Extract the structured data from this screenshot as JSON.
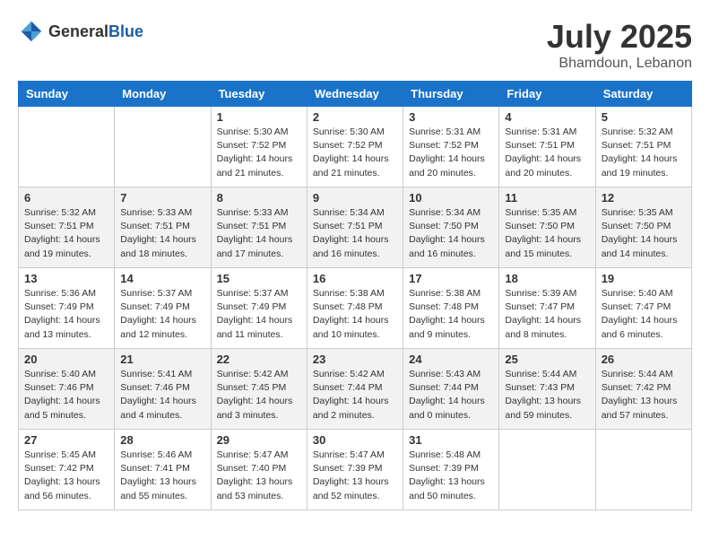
{
  "header": {
    "logo_general": "General",
    "logo_blue": "Blue",
    "month_year": "July 2025",
    "location": "Bhamdoun, Lebanon"
  },
  "weekdays": [
    "Sunday",
    "Monday",
    "Tuesday",
    "Wednesday",
    "Thursday",
    "Friday",
    "Saturday"
  ],
  "weeks": [
    [
      {
        "day": "",
        "sunrise": "",
        "sunset": "",
        "daylight": ""
      },
      {
        "day": "",
        "sunrise": "",
        "sunset": "",
        "daylight": ""
      },
      {
        "day": "1",
        "sunrise": "Sunrise: 5:30 AM",
        "sunset": "Sunset: 7:52 PM",
        "daylight": "Daylight: 14 hours and 21 minutes."
      },
      {
        "day": "2",
        "sunrise": "Sunrise: 5:30 AM",
        "sunset": "Sunset: 7:52 PM",
        "daylight": "Daylight: 14 hours and 21 minutes."
      },
      {
        "day": "3",
        "sunrise": "Sunrise: 5:31 AM",
        "sunset": "Sunset: 7:52 PM",
        "daylight": "Daylight: 14 hours and 20 minutes."
      },
      {
        "day": "4",
        "sunrise": "Sunrise: 5:31 AM",
        "sunset": "Sunset: 7:51 PM",
        "daylight": "Daylight: 14 hours and 20 minutes."
      },
      {
        "day": "5",
        "sunrise": "Sunrise: 5:32 AM",
        "sunset": "Sunset: 7:51 PM",
        "daylight": "Daylight: 14 hours and 19 minutes."
      }
    ],
    [
      {
        "day": "6",
        "sunrise": "Sunrise: 5:32 AM",
        "sunset": "Sunset: 7:51 PM",
        "daylight": "Daylight: 14 hours and 19 minutes."
      },
      {
        "day": "7",
        "sunrise": "Sunrise: 5:33 AM",
        "sunset": "Sunset: 7:51 PM",
        "daylight": "Daylight: 14 hours and 18 minutes."
      },
      {
        "day": "8",
        "sunrise": "Sunrise: 5:33 AM",
        "sunset": "Sunset: 7:51 PM",
        "daylight": "Daylight: 14 hours and 17 minutes."
      },
      {
        "day": "9",
        "sunrise": "Sunrise: 5:34 AM",
        "sunset": "Sunset: 7:51 PM",
        "daylight": "Daylight: 14 hours and 16 minutes."
      },
      {
        "day": "10",
        "sunrise": "Sunrise: 5:34 AM",
        "sunset": "Sunset: 7:50 PM",
        "daylight": "Daylight: 14 hours and 16 minutes."
      },
      {
        "day": "11",
        "sunrise": "Sunrise: 5:35 AM",
        "sunset": "Sunset: 7:50 PM",
        "daylight": "Daylight: 14 hours and 15 minutes."
      },
      {
        "day": "12",
        "sunrise": "Sunrise: 5:35 AM",
        "sunset": "Sunset: 7:50 PM",
        "daylight": "Daylight: 14 hours and 14 minutes."
      }
    ],
    [
      {
        "day": "13",
        "sunrise": "Sunrise: 5:36 AM",
        "sunset": "Sunset: 7:49 PM",
        "daylight": "Daylight: 14 hours and 13 minutes."
      },
      {
        "day": "14",
        "sunrise": "Sunrise: 5:37 AM",
        "sunset": "Sunset: 7:49 PM",
        "daylight": "Daylight: 14 hours and 12 minutes."
      },
      {
        "day": "15",
        "sunrise": "Sunrise: 5:37 AM",
        "sunset": "Sunset: 7:49 PM",
        "daylight": "Daylight: 14 hours and 11 minutes."
      },
      {
        "day": "16",
        "sunrise": "Sunrise: 5:38 AM",
        "sunset": "Sunset: 7:48 PM",
        "daylight": "Daylight: 14 hours and 10 minutes."
      },
      {
        "day": "17",
        "sunrise": "Sunrise: 5:38 AM",
        "sunset": "Sunset: 7:48 PM",
        "daylight": "Daylight: 14 hours and 9 minutes."
      },
      {
        "day": "18",
        "sunrise": "Sunrise: 5:39 AM",
        "sunset": "Sunset: 7:47 PM",
        "daylight": "Daylight: 14 hours and 8 minutes."
      },
      {
        "day": "19",
        "sunrise": "Sunrise: 5:40 AM",
        "sunset": "Sunset: 7:47 PM",
        "daylight": "Daylight: 14 hours and 6 minutes."
      }
    ],
    [
      {
        "day": "20",
        "sunrise": "Sunrise: 5:40 AM",
        "sunset": "Sunset: 7:46 PM",
        "daylight": "Daylight: 14 hours and 5 minutes."
      },
      {
        "day": "21",
        "sunrise": "Sunrise: 5:41 AM",
        "sunset": "Sunset: 7:46 PM",
        "daylight": "Daylight: 14 hours and 4 minutes."
      },
      {
        "day": "22",
        "sunrise": "Sunrise: 5:42 AM",
        "sunset": "Sunset: 7:45 PM",
        "daylight": "Daylight: 14 hours and 3 minutes."
      },
      {
        "day": "23",
        "sunrise": "Sunrise: 5:42 AM",
        "sunset": "Sunset: 7:44 PM",
        "daylight": "Daylight: 14 hours and 2 minutes."
      },
      {
        "day": "24",
        "sunrise": "Sunrise: 5:43 AM",
        "sunset": "Sunset: 7:44 PM",
        "daylight": "Daylight: 14 hours and 0 minutes."
      },
      {
        "day": "25",
        "sunrise": "Sunrise: 5:44 AM",
        "sunset": "Sunset: 7:43 PM",
        "daylight": "Daylight: 13 hours and 59 minutes."
      },
      {
        "day": "26",
        "sunrise": "Sunrise: 5:44 AM",
        "sunset": "Sunset: 7:42 PM",
        "daylight": "Daylight: 13 hours and 57 minutes."
      }
    ],
    [
      {
        "day": "27",
        "sunrise": "Sunrise: 5:45 AM",
        "sunset": "Sunset: 7:42 PM",
        "daylight": "Daylight: 13 hours and 56 minutes."
      },
      {
        "day": "28",
        "sunrise": "Sunrise: 5:46 AM",
        "sunset": "Sunset: 7:41 PM",
        "daylight": "Daylight: 13 hours and 55 minutes."
      },
      {
        "day": "29",
        "sunrise": "Sunrise: 5:47 AM",
        "sunset": "Sunset: 7:40 PM",
        "daylight": "Daylight: 13 hours and 53 minutes."
      },
      {
        "day": "30",
        "sunrise": "Sunrise: 5:47 AM",
        "sunset": "Sunset: 7:39 PM",
        "daylight": "Daylight: 13 hours and 52 minutes."
      },
      {
        "day": "31",
        "sunrise": "Sunrise: 5:48 AM",
        "sunset": "Sunset: 7:39 PM",
        "daylight": "Daylight: 13 hours and 50 minutes."
      },
      {
        "day": "",
        "sunrise": "",
        "sunset": "",
        "daylight": ""
      },
      {
        "day": "",
        "sunrise": "",
        "sunset": "",
        "daylight": ""
      }
    ]
  ]
}
